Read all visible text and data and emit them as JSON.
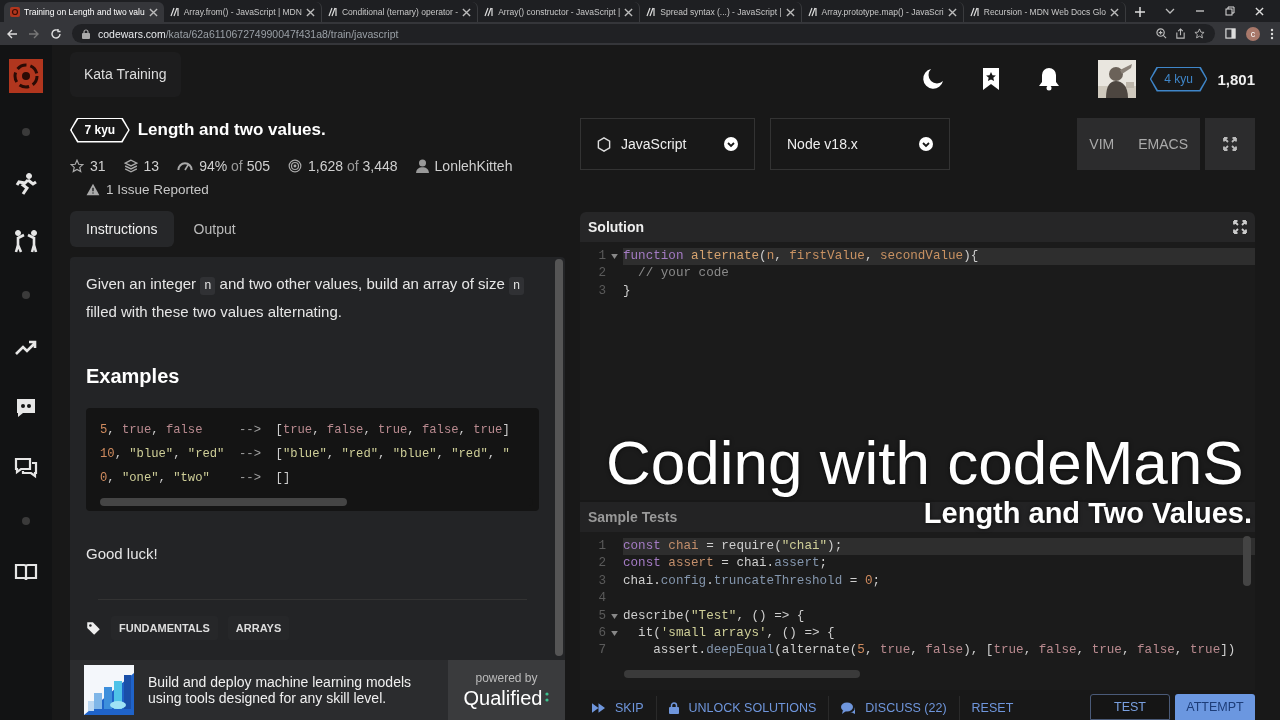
{
  "browser": {
    "tabs": [
      {
        "title": "Training on Length and two valu",
        "kind": "codewars",
        "selected": true
      },
      {
        "title": "Array.from() - JavaScript | MDN",
        "kind": "mdn",
        "selected": false
      },
      {
        "title": "Conditional (ternary) operator -",
        "kind": "mdn",
        "selected": false
      },
      {
        "title": "Array() constructor - JavaScript |",
        "kind": "mdn",
        "selected": false
      },
      {
        "title": "Spread syntax (...) - JavaScript |",
        "kind": "mdn",
        "selected": false
      },
      {
        "title": "Array.prototype.map() - JavaScri",
        "kind": "mdn",
        "selected": false
      },
      {
        "title": "Recursion - MDN Web Docs Glo",
        "kind": "mdn",
        "selected": false
      }
    ],
    "address": {
      "host": "codewars.com",
      "path": "/kata/62a611067274990047f431a8/train/javascript"
    },
    "profile_initial": "c"
  },
  "header": {
    "section": "Kata Training",
    "rank": "4 kyu",
    "honor": "1,801"
  },
  "kata": {
    "rank": "7 kyu",
    "title": "Length and two values.",
    "stats": [
      {
        "kind": "stars",
        "main": "31"
      },
      {
        "kind": "collections",
        "main": "13"
      },
      {
        "kind": "satisfaction",
        "main": "94%",
        "joiner": "of",
        "total": "505"
      },
      {
        "kind": "completed",
        "main": "1,628",
        "joiner": "of",
        "total": "3,448"
      },
      {
        "kind": "author",
        "main": "LonlehKitteh"
      }
    ],
    "issues": "1 Issue Reported"
  },
  "tabs": [
    {
      "label": "Instructions",
      "selected": true
    },
    {
      "label": "Output",
      "selected": false
    }
  ],
  "instructions": {
    "description": [
      {
        "text": "Given an integer "
      },
      {
        "code": "n"
      },
      {
        "text": " and two other values, build an array of size "
      },
      {
        "code": "n"
      },
      {
        "text": " filled with these two values alternating."
      }
    ],
    "heading": "Examples",
    "example_lines": [
      [
        {
          "kind": "num",
          "text": "5"
        },
        {
          "kind": "plain",
          "text": ", "
        },
        {
          "kind": "bool",
          "text": "true"
        },
        {
          "kind": "plain",
          "text": ", "
        },
        {
          "kind": "bool",
          "text": "false"
        },
        {
          "kind": "op",
          "text": "     -->"
        },
        {
          "kind": "plain",
          "text": "  ["
        },
        {
          "kind": "bool",
          "text": "true"
        },
        {
          "kind": "plain",
          "text": ", "
        },
        {
          "kind": "bool",
          "text": "false"
        },
        {
          "kind": "plain",
          "text": ", "
        },
        {
          "kind": "bool",
          "text": "true"
        },
        {
          "kind": "plain",
          "text": ", "
        },
        {
          "kind": "bool",
          "text": "false"
        },
        {
          "kind": "plain",
          "text": ", "
        },
        {
          "kind": "bool",
          "text": "true"
        },
        {
          "kind": "plain",
          "text": "]"
        }
      ],
      [
        {
          "kind": "num",
          "text": "10"
        },
        {
          "kind": "plain",
          "text": ", "
        },
        {
          "kind": "str",
          "text": "\"blue\""
        },
        {
          "kind": "plain",
          "text": ", "
        },
        {
          "kind": "str",
          "text": "\"red\""
        },
        {
          "kind": "op",
          "text": "  -->"
        },
        {
          "kind": "plain",
          "text": "  ["
        },
        {
          "kind": "str",
          "text": "\"blue\""
        },
        {
          "kind": "plain",
          "text": ", "
        },
        {
          "kind": "str",
          "text": "\"red\""
        },
        {
          "kind": "plain",
          "text": ", "
        },
        {
          "kind": "str",
          "text": "\"blue\""
        },
        {
          "kind": "plain",
          "text": ", "
        },
        {
          "kind": "str",
          "text": "\"red\""
        },
        {
          "kind": "plain",
          "text": ", "
        },
        {
          "kind": "str",
          "text": "\""
        }
      ],
      [
        {
          "kind": "num",
          "text": "0"
        },
        {
          "kind": "plain",
          "text": ", "
        },
        {
          "kind": "str",
          "text": "\"one\""
        },
        {
          "kind": "plain",
          "text": ", "
        },
        {
          "kind": "str",
          "text": "\"two\""
        },
        {
          "kind": "op",
          "text": "    -->"
        },
        {
          "kind": "plain",
          "text": "  []"
        }
      ]
    ],
    "closing": "Good luck!",
    "tags": [
      "FUNDAMENTALS",
      "ARRAYS"
    ]
  },
  "ad": {
    "text": "Build and deploy machine learning models using tools designed for any skill level.",
    "powered_by": "powered by",
    "brand": "Qualified"
  },
  "editor_settings": {
    "language": "JavaScript",
    "version": "Node v18.x",
    "modes": [
      "VIM",
      "EMACS"
    ]
  },
  "solution": {
    "title": "Solution",
    "lines": [
      {
        "n": "1",
        "fold": true,
        "active": true,
        "tokens": [
          {
            "kind": "kw",
            "text": "function "
          },
          {
            "kind": "fn",
            "text": "alternate"
          },
          {
            "kind": "plain",
            "text": "("
          },
          {
            "kind": "param",
            "text": "n"
          },
          {
            "kind": "plain",
            "text": ", "
          },
          {
            "kind": "param",
            "text": "firstValue"
          },
          {
            "kind": "plain",
            "text": ", "
          },
          {
            "kind": "param",
            "text": "secondValue"
          },
          {
            "kind": "plain",
            "text": "){"
          }
        ]
      },
      {
        "n": "2",
        "fold": false,
        "active": false,
        "tokens": [
          {
            "kind": "comment",
            "text": "  // your code"
          }
        ]
      },
      {
        "n": "3",
        "fold": false,
        "active": false,
        "tokens": [
          {
            "kind": "plain",
            "text": "}"
          }
        ]
      }
    ]
  },
  "sample_tests": {
    "title": "Sample Tests",
    "lines": [
      {
        "n": "1",
        "fold": false,
        "active": true,
        "tokens": [
          {
            "kind": "kw",
            "text": "const "
          },
          {
            "kind": "var",
            "text": "chai"
          },
          {
            "kind": "plain",
            "text": " = require("
          },
          {
            "kind": "str",
            "text": "\"chai\""
          },
          {
            "kind": "plain",
            "text": ");"
          }
        ]
      },
      {
        "n": "2",
        "fold": false,
        "active": false,
        "tokens": [
          {
            "kind": "kw",
            "text": "const "
          },
          {
            "kind": "var",
            "text": "assert"
          },
          {
            "kind": "plain",
            "text": " = chai."
          },
          {
            "kind": "prop",
            "text": "assert"
          },
          {
            "kind": "plain",
            "text": ";"
          }
        ]
      },
      {
        "n": "3",
        "fold": false,
        "active": false,
        "tokens": [
          {
            "kind": "plain",
            "text": "chai."
          },
          {
            "kind": "prop",
            "text": "config"
          },
          {
            "kind": "plain",
            "text": "."
          },
          {
            "kind": "prop",
            "text": "truncateThreshold"
          },
          {
            "kind": "plain",
            "text": " = "
          },
          {
            "kind": "num",
            "text": "0"
          },
          {
            "kind": "plain",
            "text": ";"
          }
        ]
      },
      {
        "n": "4",
        "fold": false,
        "active": false
      },
      {
        "n": "5",
        "fold": true,
        "active": false,
        "tokens": [
          {
            "kind": "plain",
            "text": "describe("
          },
          {
            "kind": "str",
            "text": "\"Test\""
          },
          {
            "kind": "plain",
            "text": ", () => {"
          }
        ]
      },
      {
        "n": "6",
        "fold": true,
        "active": false,
        "tokens": [
          {
            "kind": "plain",
            "text": "  it("
          },
          {
            "kind": "str",
            "text": "'small arrays'"
          },
          {
            "kind": "plain",
            "text": ", () => {"
          }
        ]
      },
      {
        "n": "7",
        "fold": false,
        "active": false,
        "tokens": [
          {
            "kind": "plain",
            "text": "    assert."
          },
          {
            "kind": "prop",
            "text": "deepEqual"
          },
          {
            "kind": "plain",
            "text": "(alternate("
          },
          {
            "kind": "num",
            "text": "5"
          },
          {
            "kind": "plain",
            "text": ", "
          },
          {
            "kind": "bool",
            "text": "true"
          },
          {
            "kind": "plain",
            "text": ", "
          },
          {
            "kind": "bool",
            "text": "false"
          },
          {
            "kind": "plain",
            "text": "), ["
          },
          {
            "kind": "bool",
            "text": "true"
          },
          {
            "kind": "plain",
            "text": ", "
          },
          {
            "kind": "bool",
            "text": "false"
          },
          {
            "kind": "plain",
            "text": ", "
          },
          {
            "kind": "bool",
            "text": "true"
          },
          {
            "kind": "plain",
            "text": ", "
          },
          {
            "kind": "bool",
            "text": "false"
          },
          {
            "kind": "plain",
            "text": ", "
          },
          {
            "kind": "bool",
            "text": "true"
          },
          {
            "kind": "plain",
            "text": "])"
          }
        ]
      }
    ]
  },
  "actions": [
    {
      "label": "SKIP",
      "kind": "skip"
    },
    {
      "label": "UNLOCK SOLUTIONS",
      "kind": "unlock"
    },
    {
      "label": "DISCUSS (22)",
      "kind": "discuss"
    },
    {
      "label": "RESET",
      "kind": "reset"
    },
    {
      "label": "TEST",
      "kind": "test"
    },
    {
      "label": "ATTEMPT",
      "kind": "attempt"
    }
  ],
  "overlay": {
    "title": "Coding with codeManS",
    "subtitle": "Length and Two Values."
  }
}
